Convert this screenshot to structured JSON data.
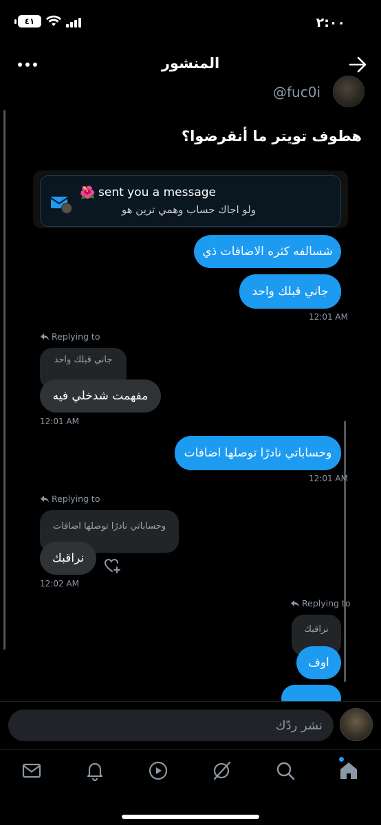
{
  "status_bar": {
    "time": "٢:٠٠",
    "battery": "٤١"
  },
  "header": {
    "title": "المنشور"
  },
  "author": {
    "handle": "@fuc0i"
  },
  "post": {
    "text": "هطوف تويتر ما أنقرضوا؟"
  },
  "notification_card": {
    "emoji": "🌺",
    "title": "sent you a message",
    "subtitle": "ولو اجاك حساب وهمي ترين هو"
  },
  "messages": {
    "m1": "شسالفه كثره الاضافات ذي",
    "m2": "جاني قبلك واحد",
    "ts1": "12:01 AM",
    "replying_1": "Replying to",
    "quote_1": "جاني قبلك واحد",
    "m3": "مفهمت شدخلي فيه",
    "ts2": "12:01 AM",
    "m4": "وحساباتي نادرًا توصلها اضافات",
    "ts3": "12:01 AM",
    "replying_2": "Replying to",
    "quote_2": "وحساباتي نادرًا توصلها اضافات",
    "m5": "نراقبك",
    "ts4": "12:02 AM",
    "replying_3": "Replying to",
    "quote_3": "نراقبك",
    "m6": "اوف"
  },
  "reply_bar": {
    "placeholder": "نشر ردّك"
  },
  "nav": {
    "items": [
      "mail-icon",
      "bell-icon",
      "play-icon",
      "grok-icon",
      "search-icon",
      "home-icon"
    ]
  },
  "colors": {
    "accent": "#1d9bf0",
    "bubble_gray": "#2f3336",
    "muted": "#8b98a5"
  }
}
